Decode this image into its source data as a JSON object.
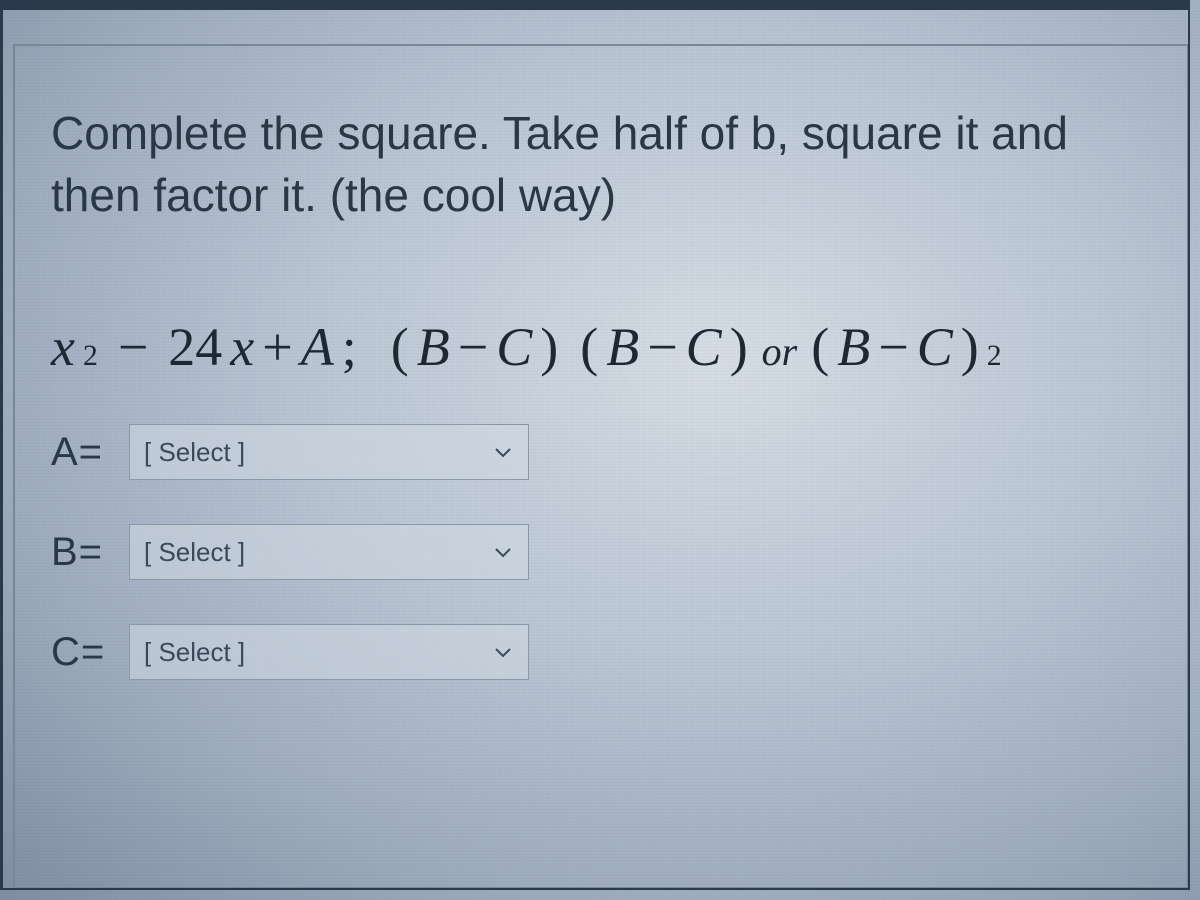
{
  "prompt": "Complete the square. Take half of b, square it and then factor it. (the cool way)",
  "math": {
    "x": "x",
    "sq1": "2",
    "minus": "−",
    "coef": "24",
    "x2": "x",
    "plus": " + ",
    "A": "A",
    "semi": ";",
    "lp1": "(",
    "B1": "B",
    "m2": " − ",
    "C1": "C",
    "rp1": ")",
    "lp2": "(",
    "B2": "B",
    "m3": " − ",
    "C2": "C",
    "rp2": ")",
    "or": "or",
    "lp3": "(",
    "B3": "B",
    "m4": " − ",
    "C3": "C",
    "rp3": ")",
    "sq2": "2"
  },
  "answers": {
    "A": {
      "label": "A=",
      "placeholder": "[ Select ]"
    },
    "B": {
      "label": "B=",
      "placeholder": "[ Select ]"
    },
    "C": {
      "label": "C=",
      "placeholder": "[ Select ]"
    }
  }
}
